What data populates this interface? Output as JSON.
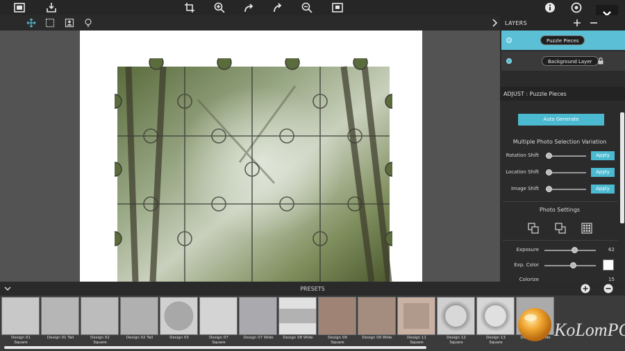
{
  "panel": {
    "layers_title": "LAYERS",
    "layers": [
      {
        "name": "Puzzle Pieces",
        "active": true
      },
      {
        "name": "Background Layer",
        "active": false,
        "locked": true
      }
    ],
    "adjust_title": "ADJUST : Puzzle Pieces",
    "auto_generate": "Auto Generate",
    "variation_title": "Multiple Photo Selection Variation",
    "sliders": [
      {
        "label": "Rotation Shift",
        "apply": "Apply",
        "level": 0.0
      },
      {
        "label": "Location Shift",
        "apply": "Apply",
        "level": 0.0
      },
      {
        "label": "Image Shift",
        "apply": "Apply",
        "level": 0.0
      }
    ],
    "photo_settings_title": "Photo Settings",
    "exposure": {
      "label": "Exposure",
      "value": "62",
      "level": 0.62
    },
    "exp_color": {
      "label": "Exp. Color",
      "color": "#ffffff",
      "level": 0.55
    },
    "colorize": {
      "label": "Colorize",
      "value": "15"
    }
  },
  "presets": {
    "title": "PRESETS",
    "items": [
      {
        "label": "Design 01\nSquare"
      },
      {
        "label": "Design 01 Tall"
      },
      {
        "label": "Design 02\nSquare"
      },
      {
        "label": "Design 02 Tall"
      },
      {
        "label": "Design 03"
      },
      {
        "label": "Design 07\nSquare"
      },
      {
        "label": "Design 07 Wide"
      },
      {
        "label": "Design 08 Wide"
      },
      {
        "label": "Design 09\nSquare"
      },
      {
        "label": "Design 09 Wide"
      },
      {
        "label": "Design 11\nSquare"
      },
      {
        "label": "Design 12\nSquare"
      },
      {
        "label": "Design 13\nSquare"
      },
      {
        "label": "Design 14 Wide"
      }
    ]
  },
  "watermark": {
    "text": "KoLomPC"
  },
  "colors": {
    "accent": "#4bb9d0",
    "panel": "#2b2b2b",
    "canvas": "#535353"
  }
}
